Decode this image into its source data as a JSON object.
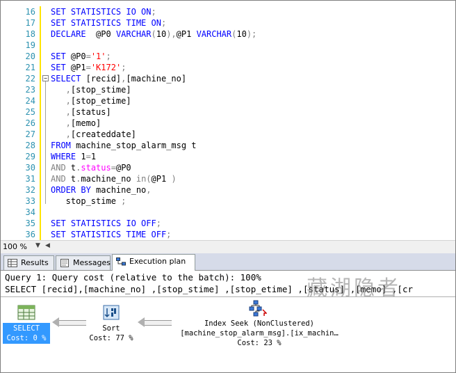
{
  "editor": {
    "lines": [
      {
        "n": "16",
        "parts": [
          [
            "kw",
            "SET STATISTICS IO ON"
          ],
          [
            "gry",
            ";"
          ]
        ]
      },
      {
        "n": "17",
        "parts": [
          [
            "kw",
            "SET STATISTICS TIME ON"
          ],
          [
            "gry",
            ";"
          ]
        ]
      },
      {
        "n": "18",
        "parts": [
          [
            "kw",
            "DECLARE  "
          ],
          [
            "plain",
            "@P0 "
          ],
          [
            "kw",
            "VARCHAR"
          ],
          [
            "gry",
            "("
          ],
          [
            "plain",
            "10"
          ],
          [
            "gry",
            "),"
          ],
          [
            "plain",
            "@P1 "
          ],
          [
            "kw",
            "VARCHAR"
          ],
          [
            "gry",
            "("
          ],
          [
            "plain",
            "10"
          ],
          [
            "gry",
            ");"
          ]
        ]
      },
      {
        "n": "19",
        "parts": []
      },
      {
        "n": "20",
        "parts": [
          [
            "kw",
            "SET "
          ],
          [
            "plain",
            "@P0"
          ],
          [
            "gry",
            "="
          ],
          [
            "str",
            "'1'"
          ],
          [
            "gry",
            ";"
          ]
        ]
      },
      {
        "n": "21",
        "parts": [
          [
            "kw",
            "SET "
          ],
          [
            "plain",
            "@P1"
          ],
          [
            "gry",
            "="
          ],
          [
            "str",
            "'K172'"
          ],
          [
            "gry",
            ";"
          ]
        ]
      },
      {
        "n": "22",
        "parts": [
          [
            "kw",
            "SELECT "
          ],
          [
            "plain",
            "[recid]"
          ],
          [
            "gry",
            ","
          ],
          [
            "plain",
            "[machine_no]"
          ]
        ]
      },
      {
        "n": "23",
        "parts": [
          [
            "gry",
            "   ,"
          ],
          [
            "plain",
            "[stop_stime]"
          ]
        ]
      },
      {
        "n": "24",
        "parts": [
          [
            "gry",
            "   ,"
          ],
          [
            "plain",
            "[stop_etime]"
          ]
        ]
      },
      {
        "n": "25",
        "parts": [
          [
            "gry",
            "   ,"
          ],
          [
            "plain",
            "[status]"
          ]
        ]
      },
      {
        "n": "26",
        "parts": [
          [
            "gry",
            "   ,"
          ],
          [
            "plain",
            "[memo]"
          ]
        ]
      },
      {
        "n": "27",
        "parts": [
          [
            "gry",
            "   ,"
          ],
          [
            "plain",
            "[createddate]"
          ]
        ]
      },
      {
        "n": "28",
        "parts": [
          [
            "kw",
            "FROM "
          ],
          [
            "plain",
            "machine_stop_alarm_msg t"
          ]
        ]
      },
      {
        "n": "29",
        "parts": [
          [
            "kw",
            "WHERE "
          ],
          [
            "plain",
            "1"
          ],
          [
            "gry",
            "="
          ],
          [
            "plain",
            "1"
          ]
        ]
      },
      {
        "n": "30",
        "parts": [
          [
            "gry",
            "AND "
          ],
          [
            "plain",
            "t"
          ],
          [
            "gry",
            "."
          ],
          [
            "fn",
            "status"
          ],
          [
            "gry",
            "="
          ],
          [
            "plain",
            "@P0"
          ]
        ]
      },
      {
        "n": "31",
        "parts": [
          [
            "gry",
            "AND "
          ],
          [
            "plain",
            "t"
          ],
          [
            "gry",
            "."
          ],
          [
            "plain",
            "machine_no "
          ],
          [
            "gry",
            "in("
          ],
          [
            "plain",
            "@P1 "
          ],
          [
            "gry",
            ")"
          ]
        ]
      },
      {
        "n": "32",
        "parts": [
          [
            "kw",
            "ORDER BY "
          ],
          [
            "plain",
            "machine_no"
          ],
          [
            "gry",
            ","
          ]
        ]
      },
      {
        "n": "33",
        "parts": [
          [
            "plain",
            "   stop_stime "
          ],
          [
            "gry",
            ";"
          ]
        ]
      },
      {
        "n": "34",
        "parts": []
      },
      {
        "n": "35",
        "parts": [
          [
            "kw",
            "SET STATISTICS IO OFF"
          ],
          [
            "gry",
            ";"
          ]
        ]
      },
      {
        "n": "36",
        "parts": [
          [
            "kw",
            "SET STATISTICS TIME OFF"
          ],
          [
            "gry",
            ";"
          ]
        ]
      }
    ]
  },
  "zoom": {
    "level": "100 %"
  },
  "tabs": [
    {
      "label": "Results",
      "icon": "grid-icon",
      "active": false
    },
    {
      "label": "Messages",
      "icon": "messages-icon",
      "active": false
    },
    {
      "label": "Execution plan",
      "icon": "execution-plan-icon",
      "active": true
    }
  ],
  "plan": {
    "query_header": "Query 1: Query cost (relative to the batch): 100%",
    "query_text": "SELECT [recid],[machine_no] ,[stop_stime] ,[stop_etime] ,[status] ,[memo] ,[cr",
    "watermark": "藏湖隐者",
    "nodes": {
      "select": {
        "label": "SELECT",
        "cost": "Cost: 0 %"
      },
      "sort": {
        "label": "Sort",
        "cost": "Cost: 77 %"
      },
      "seek": {
        "label": "Index Seek (NonClustered)",
        "object": "[machine_stop_alarm_msg].[ix_machin…",
        "cost": "Cost: 23 %"
      }
    }
  },
  "colors": {
    "keyword": "#0000ff",
    "string": "#ff0000",
    "operator": "#808080",
    "linenumber": "#2b91af",
    "selection": "#3399ff"
  }
}
